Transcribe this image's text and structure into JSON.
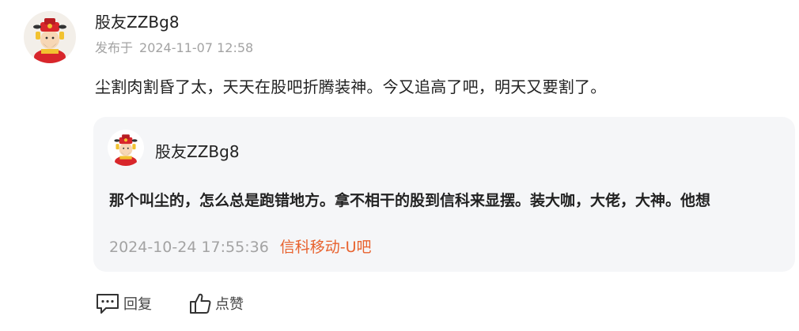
{
  "post": {
    "username": "股友ZZBg8",
    "published_label": "发布于",
    "published_time": "2024-11-07 12:58",
    "content": "尘割肉割昏了太，天天在股吧折腾装神。今又追高了吧，明天又要割了。"
  },
  "quoted": {
    "username": "股友ZZBg8",
    "content": "那个叫尘的，怎么总是跑错地方。拿不相干的股到信科来显摆。装大咖，大佬，大神。他想",
    "time": "2024-10-24 17:55:36",
    "forum": "信科移动-U吧"
  },
  "actions": {
    "reply_label": "回复",
    "like_label": "点赞"
  },
  "icons": {
    "avatar": "caishen-avatar-icon",
    "reply": "comment-icon",
    "like": "thumbs-up-icon"
  },
  "colors": {
    "forum_link": "#e8622e",
    "muted_text": "#a3a3a3",
    "quote_background": "#f5f6f8"
  }
}
